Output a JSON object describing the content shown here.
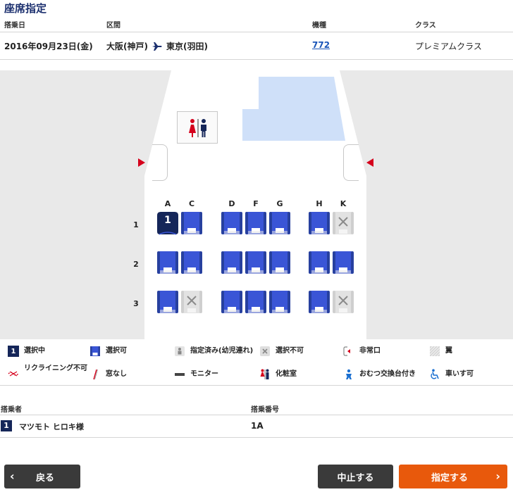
{
  "page": {
    "title": "座席指定"
  },
  "flight": {
    "headers": {
      "date": "搭乗日",
      "route": "区間",
      "aircraft": "機種",
      "class": "クラス"
    },
    "date": "2016年09月23日(金)",
    "origin": "大阪(神戸)",
    "destination": "東京(羽田)",
    "aircraft": "772",
    "seat_class": "プレミアムクラス"
  },
  "seatmap": {
    "columns": [
      "A",
      "C",
      "D",
      "F",
      "G",
      "H",
      "K"
    ],
    "rows": [
      "1",
      "2",
      "3"
    ],
    "selected_seat_number": "1",
    "seats": [
      {
        "row": "1",
        "col": "A",
        "status": "selected"
      },
      {
        "row": "1",
        "col": "C",
        "status": "available"
      },
      {
        "row": "1",
        "col": "D",
        "status": "available"
      },
      {
        "row": "1",
        "col": "F",
        "status": "available"
      },
      {
        "row": "1",
        "col": "G",
        "status": "available"
      },
      {
        "row": "1",
        "col": "H",
        "status": "available"
      },
      {
        "row": "1",
        "col": "K",
        "status": "unavailable"
      },
      {
        "row": "2",
        "col": "A",
        "status": "available"
      },
      {
        "row": "2",
        "col": "C",
        "status": "available"
      },
      {
        "row": "2",
        "col": "D",
        "status": "available"
      },
      {
        "row": "2",
        "col": "F",
        "status": "available"
      },
      {
        "row": "2",
        "col": "G",
        "status": "available"
      },
      {
        "row": "2",
        "col": "H",
        "status": "available"
      },
      {
        "row": "2",
        "col": "K",
        "status": "available"
      },
      {
        "row": "3",
        "col": "A",
        "status": "available"
      },
      {
        "row": "3",
        "col": "C",
        "status": "unavailable"
      },
      {
        "row": "3",
        "col": "D",
        "status": "available"
      },
      {
        "row": "3",
        "col": "F",
        "status": "available"
      },
      {
        "row": "3",
        "col": "G",
        "status": "available"
      },
      {
        "row": "3",
        "col": "H",
        "status": "available"
      },
      {
        "row": "3",
        "col": "K",
        "status": "unavailable"
      }
    ]
  },
  "legend": {
    "selected_badge": "1",
    "selected": "選択中",
    "available": "選択可",
    "infant_reserved": "指定済み(幼児連れ)",
    "unavailable": "選択不可",
    "emergency_exit": "非常口",
    "wing": "翼",
    "no_recline": "リクライニング不可",
    "no_window": "窓なし",
    "monitor": "モニター",
    "lavatory": "化粧室",
    "diaper_table": "おむつ交換台付き",
    "wheelchair": "車いす可"
  },
  "passengers": {
    "headers": {
      "name": "搭乗者",
      "seat": "搭乗番号"
    },
    "items": [
      {
        "index": "1",
        "name": "マツモト ヒロキ様",
        "seat": "1A"
      }
    ]
  },
  "buttons": {
    "back": "戻る",
    "cancel": "中止する",
    "confirm": "指定する",
    "back_chevron": "‹",
    "confirm_chevron": "›"
  },
  "colors": {
    "brand_navy": "#152659",
    "seat_blue": "#3a55d6",
    "accent_orange": "#e8590c",
    "exit_red": "#d5001c",
    "wing_blue": "#cfe0f9"
  }
}
